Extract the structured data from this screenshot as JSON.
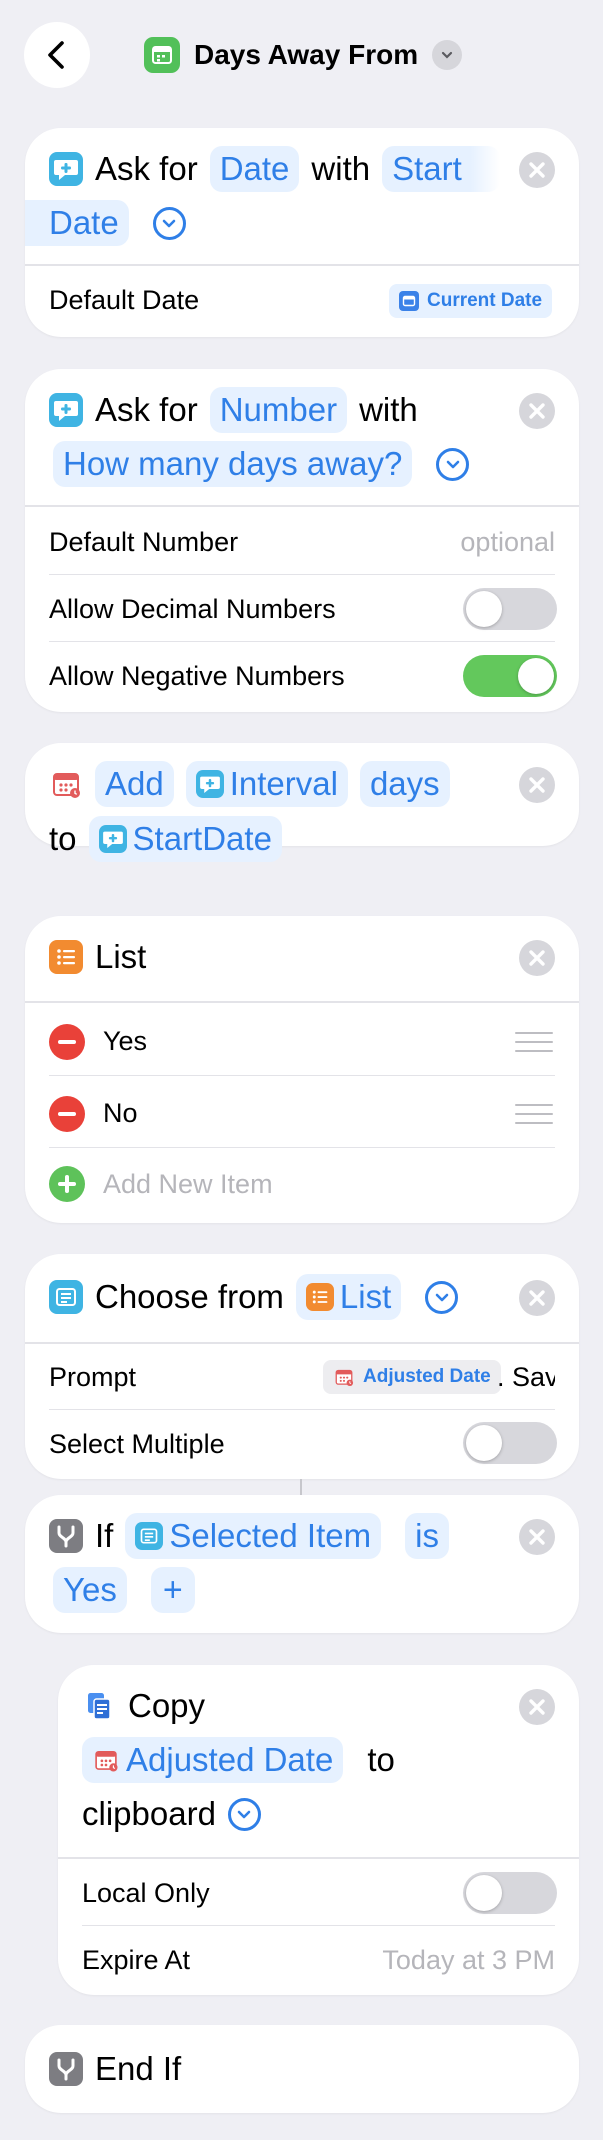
{
  "nav": {
    "title": "Days Away From",
    "back_icon": "chevron-left-icon",
    "app_icon": "calendar-icon",
    "menu_icon": "chevron-down-icon"
  },
  "colors": {
    "background": "#efeff4",
    "accent": "#2f7fe7",
    "token_bg": "#e6f1ff",
    "ask_icon": "#3fb4e3",
    "list_icon": "#f28b30",
    "if_icon": "#7d7d82",
    "toggle_on": "#63c85c",
    "remove": "#e94139",
    "add": "#5ec25a"
  },
  "actions": {
    "ask_date": {
      "verb": "Ask for",
      "type": "Date",
      "with": "with",
      "prompt_part1": "Start",
      "prompt_part2": "Date",
      "default_label": "Default Date",
      "default_value": "Current Date"
    },
    "ask_number": {
      "verb": "Ask for",
      "type": "Number",
      "with": "with",
      "prompt": "How many days away?",
      "default_label": "Default Number",
      "default_placeholder": "optional",
      "allow_decimal_label": "Allow Decimal Numbers",
      "allow_decimal": false,
      "allow_negative_label": "Allow Negative Numbers",
      "allow_negative": true
    },
    "adjust_date": {
      "operation": "Add",
      "amount_var": "Interval",
      "unit": "days",
      "to": "to",
      "target_var": "StartDate"
    },
    "list": {
      "title": "List",
      "items": [
        "Yes",
        "No"
      ],
      "add_placeholder": "Add New Item"
    },
    "choose": {
      "verb": "Choose from",
      "source": "List",
      "prompt_label": "Prompt",
      "prompt_var": "Adjusted Date",
      "prompt_suffix": ". Sav",
      "select_multiple_label": "Select Multiple",
      "select_multiple": false
    },
    "if_block": {
      "keyword": "If",
      "input_var": "Selected Item",
      "condition": "is",
      "value": "Yes",
      "add_symbol": "+"
    },
    "copy": {
      "verb": "Copy",
      "var": "Adjusted Date",
      "to": "to",
      "destination": "clipboard",
      "local_only_label": "Local Only",
      "local_only": false,
      "expire_label": "Expire At",
      "expire_placeholder": "Today at 3 PM"
    },
    "end_if": {
      "label": "End If"
    }
  }
}
